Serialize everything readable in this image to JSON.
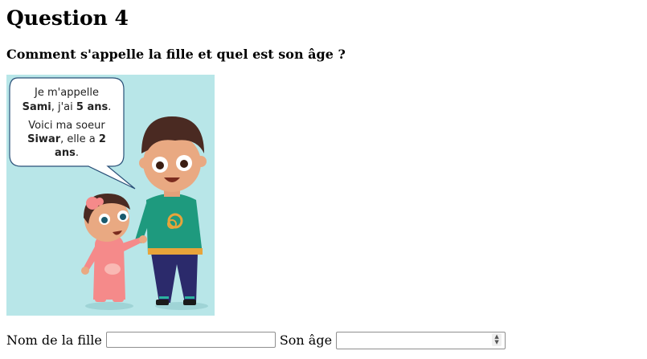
{
  "page": {
    "title": "Question 4",
    "question": "Comment s'appelle la fille et quel est son âge ?"
  },
  "speech_bubble": {
    "line1": "Je m'appelle",
    "line2_name": "Sami",
    "line2_mid": ", j'ai ",
    "line2_age": "5 ans",
    "line2_end": ".",
    "line3": "Voici ma soeur",
    "line4_name": "Siwar",
    "line4_mid": ", elle a ",
    "line4_age_num": "2",
    "line5_age_unit": "ans",
    "line5_end": "."
  },
  "form": {
    "name_label": "Nom de la fille",
    "name_value": "",
    "age_label": "Son âge",
    "age_value": ""
  },
  "colors": {
    "illustration_bg": "#b8e6e8",
    "boy_shirt": "#1e9a7e",
    "boy_pants": "#2b2a6b",
    "girl_outfit": "#f58a8a"
  }
}
